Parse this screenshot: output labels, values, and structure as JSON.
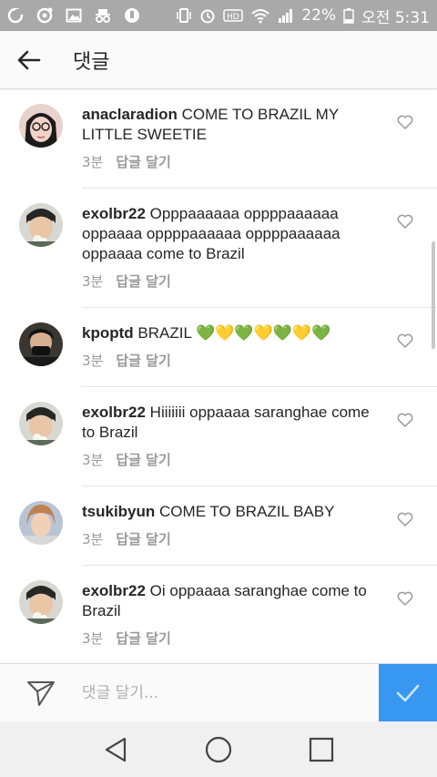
{
  "status_bar": {
    "battery": "22%",
    "time": "오전 5:31",
    "icons": [
      "g-icon",
      "record-icon",
      "image-icon",
      "incognito-icon",
      "dnd-icon",
      "vibrate-icon",
      "alarm-icon",
      "hd-icon",
      "wifi-icon",
      "signal-icon",
      "battery-icon"
    ]
  },
  "app_bar": {
    "title": "댓글",
    "back_icon": "arrow-left-icon"
  },
  "comments": [
    {
      "username": "anaclaradion",
      "text": "COME TO BRAZIL MY LITTLE SWEETIE",
      "time": "3분",
      "reply_label": "답글 달기"
    },
    {
      "username": "exolbr22",
      "text": "Opppaaaaaa oppppaaaaaa oppaaaa oppppaaaaaa oppppaaaaaa oppaaaa come to Brazil",
      "time": "3분",
      "reply_label": "답글 달기"
    },
    {
      "username": "kpoptd",
      "text": "BRAZIL 💚💛💚💛💚💛💚",
      "time": "3분",
      "reply_label": "답글 달기"
    },
    {
      "username": "exolbr22",
      "text": "Hiiiiiii oppaaaa saranghae come to Brazil",
      "time": "3분",
      "reply_label": "답글 달기"
    },
    {
      "username": "tsukibyun",
      "text": "COME TO BRAZIL BABY",
      "time": "3분",
      "reply_label": "답글 달기"
    },
    {
      "username": "exolbr22",
      "text": "Oi oppaaaa saranghae come to Brazil",
      "time": "3분",
      "reply_label": "답글 달기"
    }
  ],
  "composer": {
    "placeholder": "댓글 달기...",
    "value": ""
  },
  "colors": {
    "status_bar": "#a9a9a9",
    "accent": "#3897f0",
    "meta_text": "#999999"
  }
}
